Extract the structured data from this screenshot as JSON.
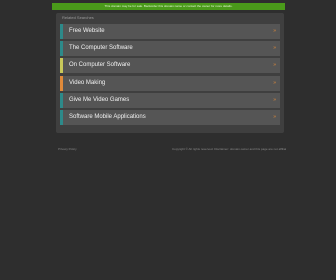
{
  "banner": {
    "text": "This domain may be for sale. Backorder this domain name or contact the owner for more details."
  },
  "panel": {
    "header": "Related Searches"
  },
  "links": [
    {
      "label": "Free Website",
      "accent": "#2d8a8a",
      "chevron": "»"
    },
    {
      "label": "The Computer Software",
      "accent": "#2d8a8a",
      "chevron": "»"
    },
    {
      "label": "On Computer Software",
      "accent": "#c8c85a",
      "chevron": "»"
    },
    {
      "label": "Video Making",
      "accent": "#e08a3a",
      "chevron": "»"
    },
    {
      "label": "Give Me Video Games",
      "accent": "#2d8a8a",
      "chevron": "»"
    },
    {
      "label": "Software Mobile Applications",
      "accent": "#2d8a8a",
      "chevron": "»"
    }
  ],
  "footer": {
    "left": "Privacy Policy",
    "right": "Copyright © All rights reserved. Disclaimer: domain owner and this page are not affiliated with advertisers."
  },
  "colors": {
    "background": "#2e2e2e",
    "panel": "#3f3f3f",
    "item": "#555555",
    "banner": "#4a9a1a",
    "chevron": "#e08a3a"
  }
}
